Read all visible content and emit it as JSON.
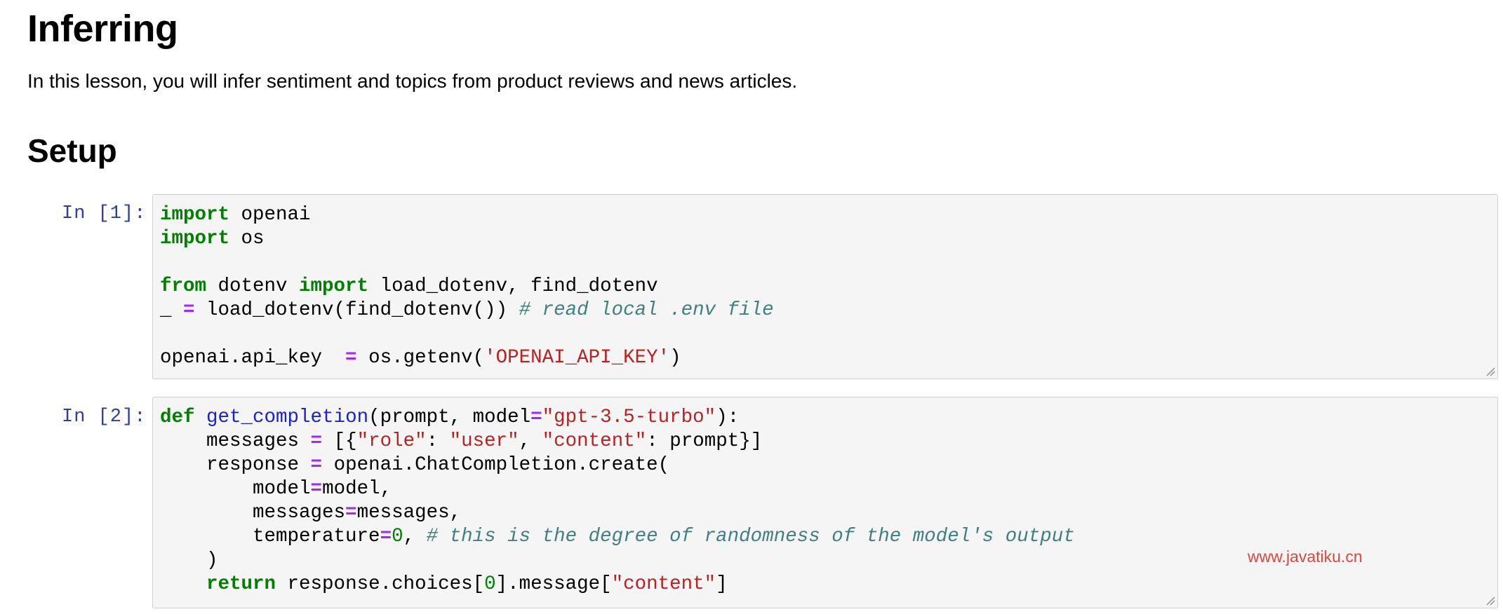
{
  "header": {
    "title": "Inferring",
    "intro": "In this lesson, you will infer sentiment and topics from product reviews and news articles.",
    "section": "Setup"
  },
  "cells": [
    {
      "prompt": "In [1]:",
      "lines": [
        "import openai",
        "import os",
        "",
        "from dotenv import load_dotenv, find_dotenv",
        "_ = load_dotenv(find_dotenv()) # read local .env file",
        "",
        "openai.api_key  = os.getenv('OPENAI_API_KEY')"
      ]
    },
    {
      "prompt": "In [2]:",
      "lines": [
        "def get_completion(prompt, model=\"gpt-3.5-turbo\"):",
        "    messages = [{\"role\": \"user\", \"content\": prompt}]",
        "    response = openai.ChatCompletion.create(",
        "        model=model,",
        "        messages=messages,",
        "        temperature=0, # this is the degree of randomness of the model's output",
        "    )",
        "    return response.choices[0].message[\"content\"]"
      ]
    }
  ],
  "watermark": "www.javatiku.cn",
  "colors": {
    "prompt": "#303f9f",
    "keyword": "#008000",
    "string": "#ba2121",
    "comment": "#408080",
    "operator": "#aa22ff",
    "function": "#1a23c9",
    "cell_bg": "#f5f5f5",
    "watermark": "#e0463a"
  }
}
